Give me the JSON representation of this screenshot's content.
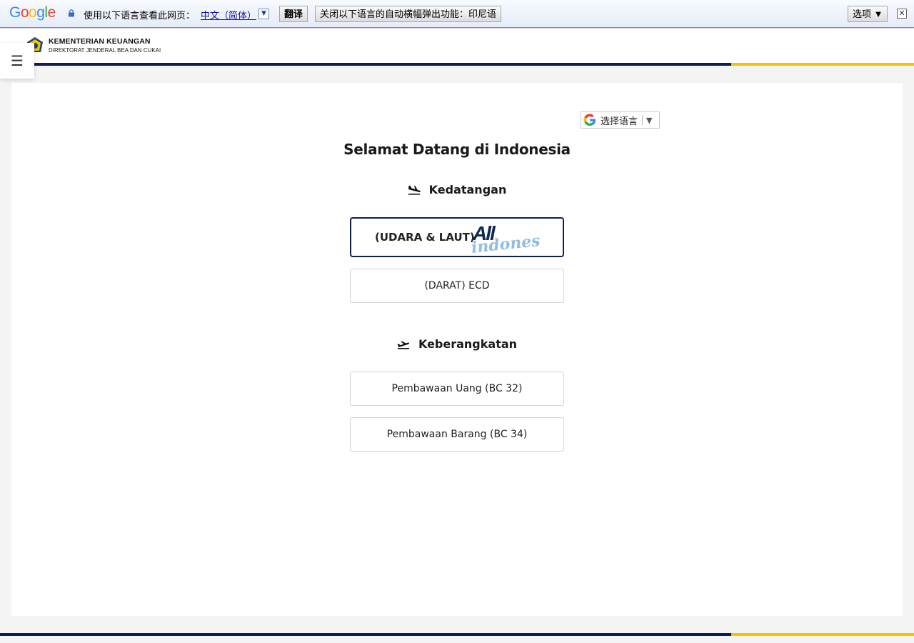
{
  "translate_bar": {
    "logo_text": "Google",
    "prompt": "使用以下语言查看此网页：",
    "language": "中文（简体）",
    "language_caret": "▼",
    "translate_button": "翻译",
    "never_translate_button": "关闭以下语言的自动横幅弹出功能：印尼语",
    "options_button": "选项 ▼",
    "close_icon": "✕"
  },
  "header": {
    "org_name": "KEMENTERIAN KEUANGAN",
    "org_sub": "DIREKTORAT JENDERAL BEA DAN CUKAI",
    "menu_icon": "☰"
  },
  "language_selector": {
    "label": "选择语言",
    "arrow": "▼"
  },
  "main": {
    "title": "Selamat Datang di Indonesia",
    "arrival": {
      "heading": "Kedatangan",
      "icon": "plane-landing-icon",
      "options": [
        {
          "label": "(UDARA & LAUT)",
          "logo": "All Indonesia"
        },
        {
          "label": "(DARAT) ECD"
        }
      ]
    },
    "departure": {
      "heading": "Keberangkatan",
      "icon": "plane-departure-icon",
      "options": [
        {
          "label": "Pembawaan Uang (BC 32)"
        },
        {
          "label": "Pembawaan Barang (BC 34)"
        }
      ]
    }
  },
  "colors": {
    "navy": "#0d1f4d",
    "gold": "#f5c400"
  }
}
